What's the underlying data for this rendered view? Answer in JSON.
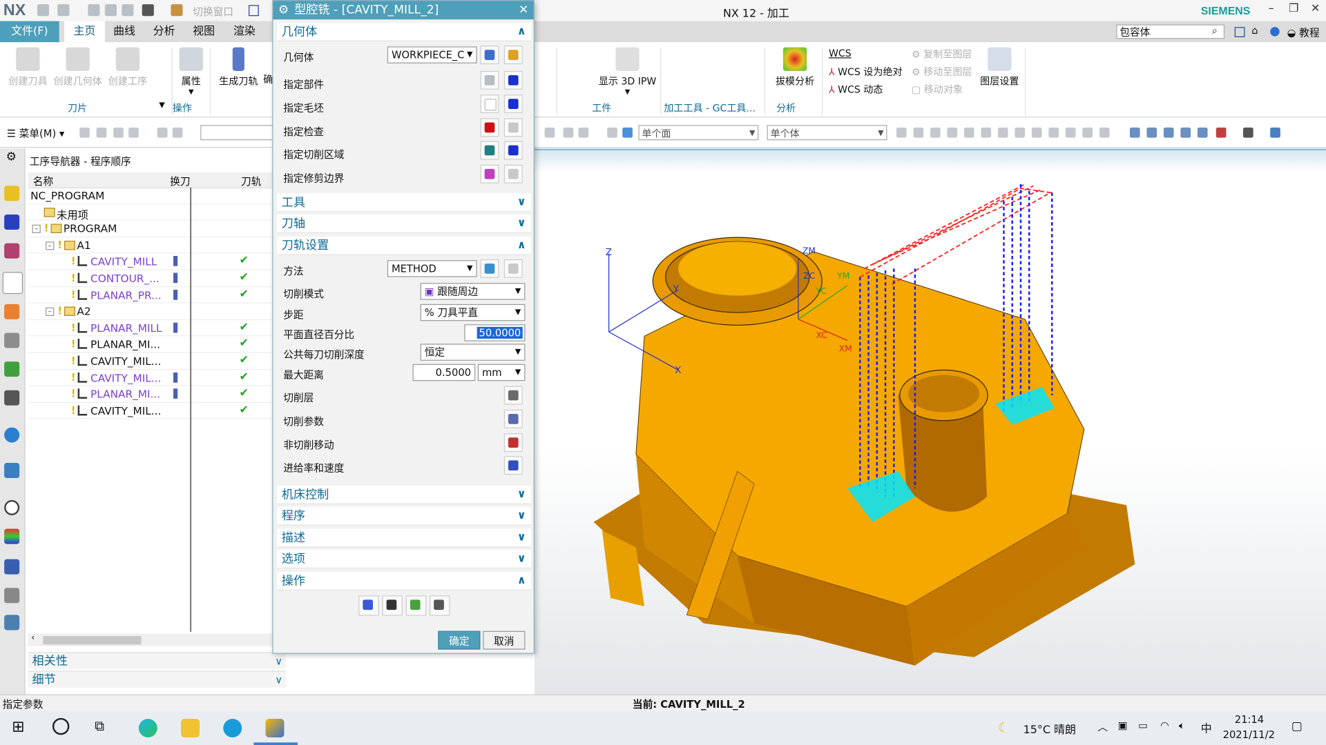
{
  "app": {
    "logo": "NX",
    "title": "NX 12 - 加工",
    "brand": "SIEMENS",
    "quick_access": {
      "switch_window": "切换窗口",
      "window": "窗"
    }
  },
  "tabs": {
    "file": "文件(F)",
    "items": [
      "主页",
      "曲线",
      "分析",
      "视图",
      "渲染"
    ],
    "selected": "主页"
  },
  "search": {
    "value": "包容体"
  },
  "help": {
    "tutorial": "教程"
  },
  "ribbon": {
    "create_tool": "创建刀具",
    "create_geometry": "创建几何体",
    "create_operation": "创建工序",
    "group_insert": "刀片",
    "properties": "属性",
    "group_operation": "操作",
    "generate_path": "生成刀轨",
    "confirm": "确",
    "show_3d_ipw": "显示 3D IPW",
    "group_workpiece": "工件",
    "group_machining_tools": "加工工具 - GC工具...",
    "draft_analysis": "拔模分析",
    "group_analysis": "分析",
    "wcs": "WCS",
    "wcs_set_absolute": "WCS 设为绝对",
    "wcs_dynamic": "WCS 动态",
    "copy_to_layer": "复制至图层",
    "move_to_layer": "移动至图层",
    "move_object": "移动对象",
    "layer_settings": "图层设置"
  },
  "toolbar": {
    "menu": "菜单(M)",
    "face_filter": "单个面",
    "body_filter": "单个体"
  },
  "navigator": {
    "title": "工序导航器 - 程序顺序",
    "columns": [
      "名称",
      "换刀",
      "刀轨"
    ],
    "rows": [
      {
        "name": "NC_PROGRAM",
        "level": 0,
        "kind": "root"
      },
      {
        "name": "未用项",
        "level": 1,
        "kind": "folder"
      },
      {
        "name": "PROGRAM",
        "level": 1,
        "kind": "folder",
        "expanded": true
      },
      {
        "name": "A1",
        "level": 2,
        "kind": "folder",
        "expanded": true
      },
      {
        "name": "CAVITY_MILL",
        "level": 3,
        "kind": "op",
        "tool_change": true,
        "path_ok": true
      },
      {
        "name": "CONTOUR_...",
        "level": 3,
        "kind": "op",
        "tool_change": true,
        "path_ok": true
      },
      {
        "name": "PLANAR_PR...",
        "level": 3,
        "kind": "op",
        "tool_change": true,
        "path_ok": true
      },
      {
        "name": "A2",
        "level": 2,
        "kind": "folder",
        "expanded": true
      },
      {
        "name": "PLANAR_MILL",
        "level": 3,
        "kind": "op",
        "tool_change": true,
        "path_ok": true
      },
      {
        "name": "PLANAR_MI...",
        "level": 3,
        "kind": "op-plain",
        "tool_change": false,
        "path_ok": true
      },
      {
        "name": "CAVITY_MIL...",
        "level": 3,
        "kind": "op-plain",
        "tool_change": false,
        "path_ok": true
      },
      {
        "name": "CAVITY_MIL...",
        "level": 3,
        "kind": "op",
        "tool_change": true,
        "path_ok": true
      },
      {
        "name": "PLANAR_MI...",
        "level": 3,
        "kind": "op",
        "tool_change": true,
        "path_ok": true
      },
      {
        "name": "CAVITY_MIL...",
        "level": 3,
        "kind": "op-plain",
        "tool_change": false,
        "path_ok": true
      }
    ],
    "panels": [
      "相关性",
      "细节"
    ]
  },
  "dialog": {
    "title": "型腔铣 - [CAVITY_MILL_2]",
    "geometry": {
      "header": "几何体",
      "geometry_label": "几何体",
      "geometry_value": "WORKPIECE_C",
      "specify_part": "指定部件",
      "specify_blank": "指定毛坯",
      "specify_check": "指定检查",
      "specify_cut_area": "指定切削区域",
      "specify_trim": "指定修剪边界"
    },
    "tool": "工具",
    "tool_axis": "刀轴",
    "path_settings": {
      "header": "刀轨设置",
      "method_label": "方法",
      "method_value": "METHOD",
      "cut_pattern_label": "切削模式",
      "cut_pattern_value": "跟随周边",
      "stepover_label": "步距",
      "stepover_value": "% 刀具平直",
      "percent_label": "平面直径百分比",
      "percent_value": "50.0000",
      "depth_label": "公共每刀切削深度",
      "depth_value": "恒定",
      "max_dist_label": "最大距离",
      "max_dist_value": "0.5000",
      "max_dist_unit": "mm",
      "cut_levels": "切削层",
      "cut_params": "切削参数",
      "non_cut_moves": "非切削移动",
      "feeds_speeds": "进给率和速度"
    },
    "machine_control": "机床控制",
    "program": "程序",
    "description": "描述",
    "options": "选项",
    "actions": "操作",
    "ok": "确定",
    "cancel": "取消"
  },
  "viewport": {
    "axes": [
      "Z",
      "Y",
      "X",
      "ZM",
      "ZC",
      "YC",
      "YM",
      "XC",
      "XM"
    ]
  },
  "status": {
    "left": "指定参数",
    "current": "当前: CAVITY_MILL_2"
  },
  "taskbar": {
    "weather": "15°C 晴朗",
    "ime": "中",
    "time": "21:14",
    "date": "2021/11/2"
  },
  "colors": {
    "accent": "#4e9fba",
    "part": "#f5a800",
    "toolpath_blue": "#1a1aff",
    "toolpath_red": "#ff2020",
    "toolpath_cyan": "#00e5ff",
    "operation_text": "#7a3fd6"
  }
}
